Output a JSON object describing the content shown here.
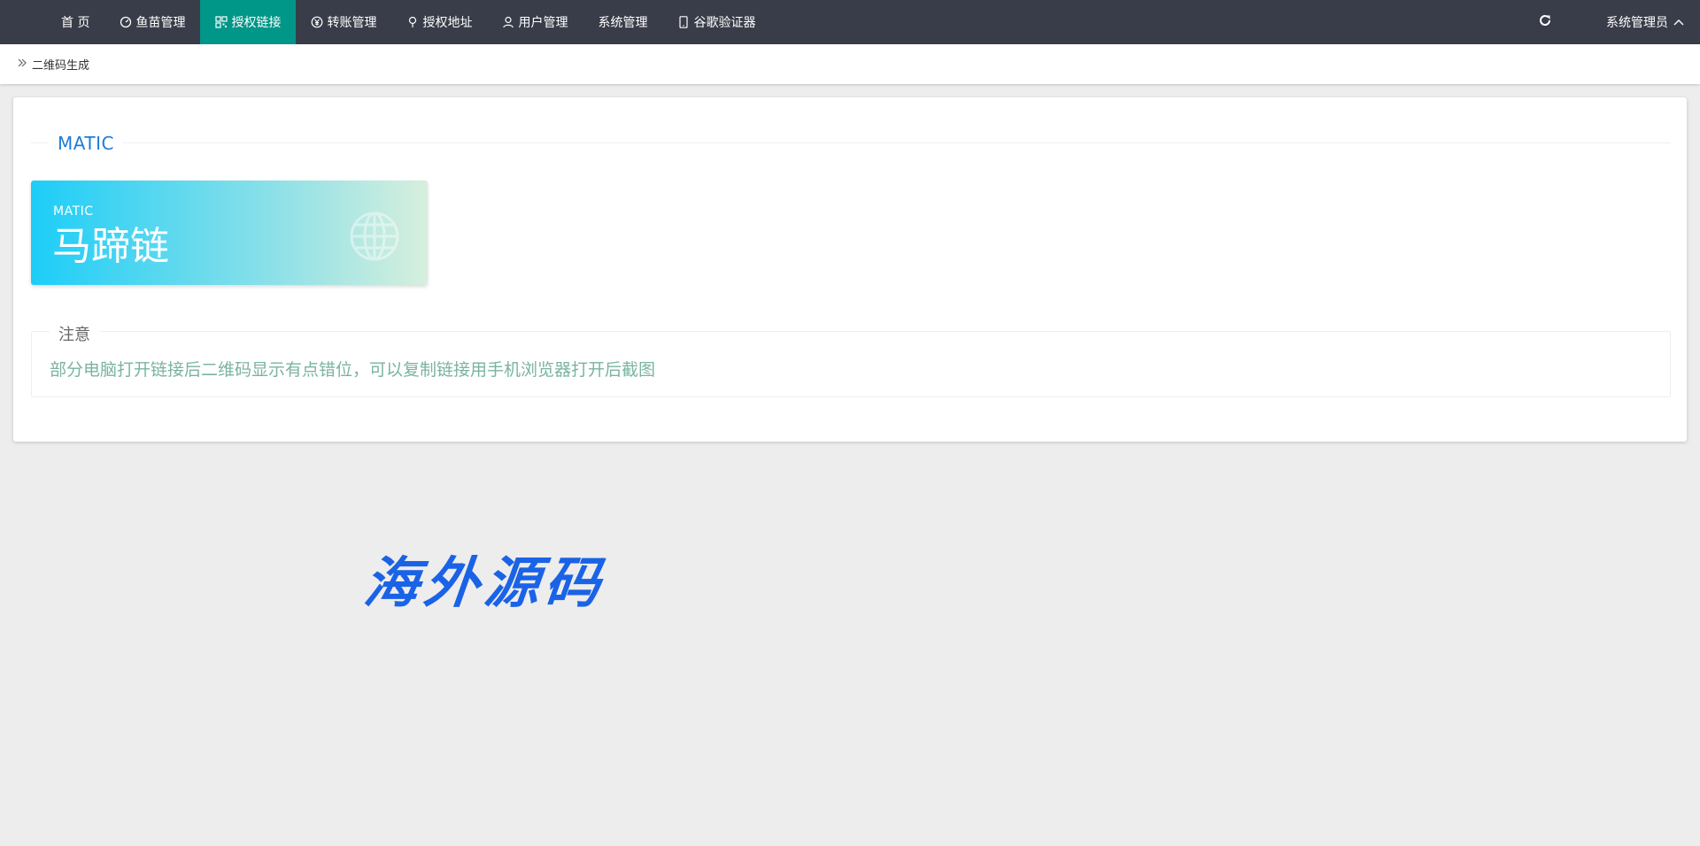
{
  "nav": {
    "items": [
      {
        "label": "首 页",
        "icon": "",
        "active": false
      },
      {
        "label": "鱼苗管理",
        "icon": "dashboard-icon",
        "active": false
      },
      {
        "label": "授权链接",
        "icon": "qrcode-icon",
        "active": true
      },
      {
        "label": "转账管理",
        "icon": "yuan-icon",
        "active": false
      },
      {
        "label": "授权地址",
        "icon": "location-pin-icon",
        "active": false
      },
      {
        "label": "用户管理",
        "icon": "user-icon",
        "active": false
      },
      {
        "label": "系统管理",
        "icon": "",
        "active": false
      },
      {
        "label": "谷歌验证器",
        "icon": "mobile-phone-icon",
        "active": false
      }
    ],
    "refresh_icon": "refresh-icon",
    "admin_label": "系统管理员",
    "admin_caret_icon": "chevron-up-icon",
    "active_color": "#009688",
    "bar_color": "#393d49"
  },
  "breadcrumb": {
    "icon": "double-chevron-right-icon",
    "label": "二维码生成"
  },
  "section": {
    "title": "MATIC",
    "title_color": "#1e7bd8"
  },
  "coin_card": {
    "code": "MATIC",
    "name": "马蹄链",
    "icon": "globe-icon"
  },
  "notice": {
    "label": "注意",
    "message": "部分电脑打开链接后二维码显示有点错位，可以复制链接用手机浏览器打开后截图"
  },
  "watermark": {
    "text": "海外源码"
  }
}
